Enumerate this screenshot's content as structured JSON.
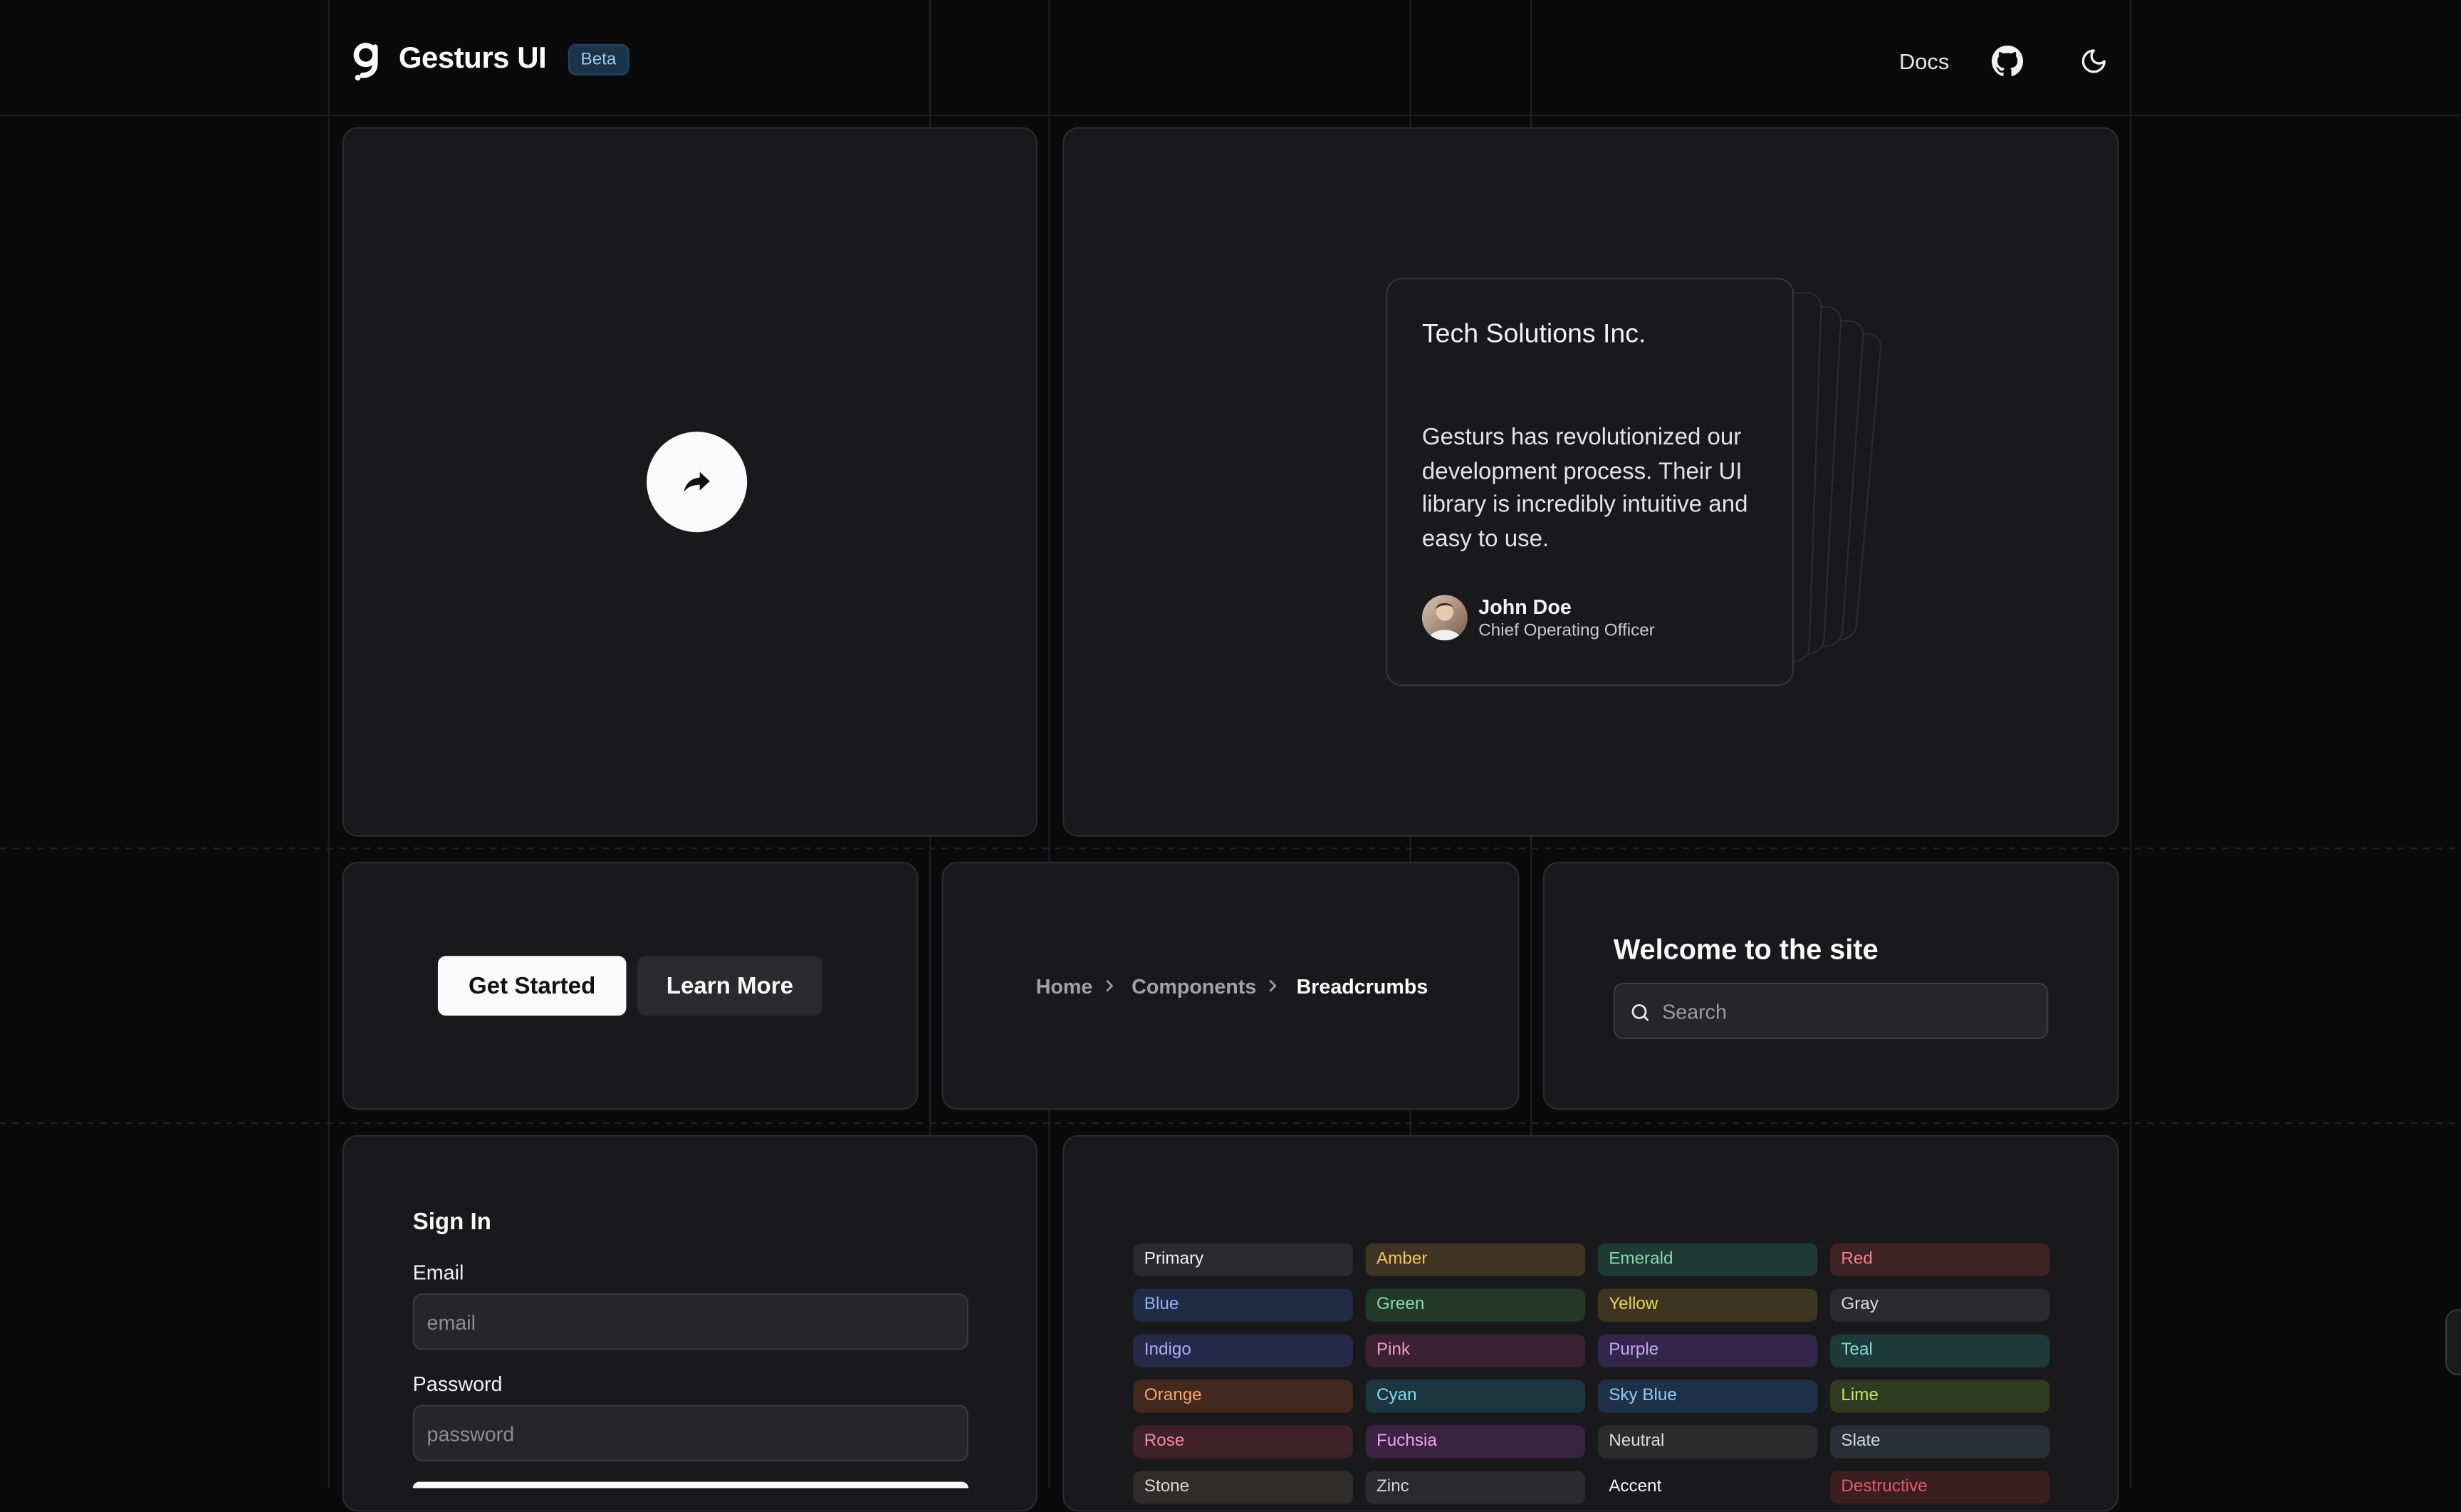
{
  "header": {
    "brand": "Gesturs UI",
    "beta": "Beta",
    "nav": {
      "docs": "Docs"
    },
    "icons": [
      "logo-icon",
      "github-icon",
      "moon-icon"
    ]
  },
  "hero": {
    "play_icon": "share-arrow-icon"
  },
  "testimonial": {
    "company": "Tech Solutions Inc.",
    "quote": "Gesturs has revolutionized our development process. Their UI library is incredibly intuitive and easy to use.",
    "name": "John Doe",
    "role": "Chief Operating Officer"
  },
  "buttons": {
    "primary": "Get Started",
    "secondary": "Learn More"
  },
  "breadcrumbs": {
    "items": [
      "Home",
      "Components",
      "Breadcrumbs"
    ]
  },
  "welcome": {
    "title": "Welcome to the site",
    "search_placeholder": "Search"
  },
  "signin": {
    "title": "Sign In",
    "email_label": "Email",
    "email_placeholder": "email",
    "password_label": "Password",
    "password_placeholder": "password"
  },
  "badges": {
    "colors": {
      "Primary": [
        "#2a2a2d",
        "#f1f1f1"
      ],
      "Amber": [
        "#3f3322",
        "#f3c560"
      ],
      "Emerald": [
        "#1f3a33",
        "#7fd9b4"
      ],
      "Red": [
        "#3e2226",
        "#f0838e"
      ],
      "Blue": [
        "#1f2c44",
        "#8fb3f3"
      ],
      "Green": [
        "#22382a",
        "#8fdc9f"
      ],
      "Yellow": [
        "#3c3620",
        "#f0d45c"
      ],
      "Gray": [
        "#2b2b2f",
        "#dcdcdc"
      ],
      "Indigo": [
        "#27294a",
        "#a9acf3"
      ],
      "Pink": [
        "#3c2230",
        "#f29ac2"
      ],
      "Purple": [
        "#32264a",
        "#c8a3f3"
      ],
      "Teal": [
        "#1e3a39",
        "#7fdfd5"
      ],
      "Orange": [
        "#41291e",
        "#f6a36a"
      ],
      "Cyan": [
        "#1d3540",
        "#82d9ee"
      ],
      "Sky Blue": [
        "#1f3148",
        "#8fcaf3"
      ],
      "Lime": [
        "#2f3a1e",
        "#c6e36a"
      ],
      "Rose": [
        "#3f2229",
        "#f38b9e"
      ],
      "Fuchsia": [
        "#3b2240",
        "#eba3ef"
      ],
      "Neutral": [
        "#2c2c2c",
        "#dadada"
      ],
      "Slate": [
        "#2a2e36",
        "#cfd6e0"
      ],
      "Stone": [
        "#2f2d2a",
        "#d8d3cc"
      ],
      "Zinc": [
        "#2b2b2e",
        "#d4d4d8"
      ],
      "Accent": [
        "#19191b",
        "#f1f1f1"
      ],
      "Destructive": [
        "#3a1e22",
        "#e05b66"
      ]
    },
    "items": [
      "Primary",
      "Amber",
      "Emerald",
      "Red",
      "Blue",
      "Green",
      "Yellow",
      "Gray",
      "Indigo",
      "Pink",
      "Purple",
      "Teal",
      "Orange",
      "Cyan",
      "Sky Blue",
      "Lime",
      "Rose",
      "Fuchsia",
      "Neutral",
      "Slate",
      "Stone",
      "Zinc",
      "Accent",
      "Destructive"
    ]
  }
}
